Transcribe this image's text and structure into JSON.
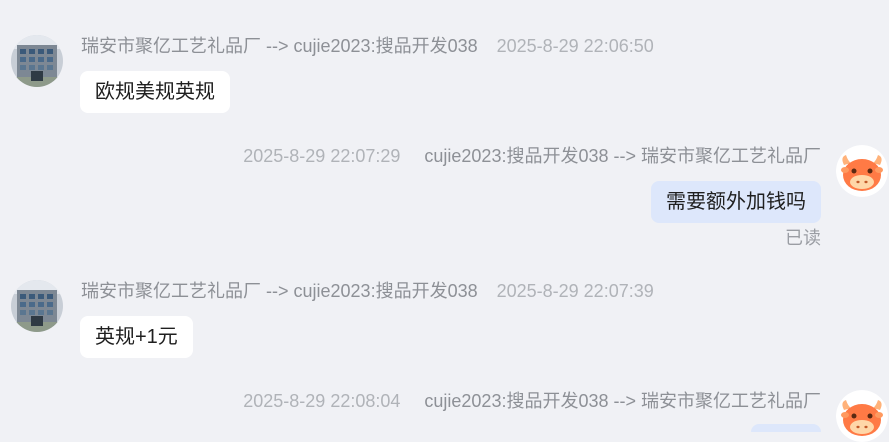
{
  "chat": {
    "messages": [
      {
        "direction": "incoming",
        "route": "瑞安市聚亿工艺礼品厂 --> cujie2023:搜品开发038",
        "time": "2025-8-29 22:06:50",
        "text": "欧规美规英规",
        "avatar_icon": "building-photo-avatar"
      },
      {
        "direction": "outgoing",
        "route": "cujie2023:搜品开发038 --> 瑞安市聚亿工艺礼品厂",
        "time": "2025-8-29 22:07:29",
        "text": "需要额外加钱吗",
        "status": "已读",
        "avatar_icon": "cow-avatar"
      },
      {
        "direction": "incoming",
        "route": "瑞安市聚亿工艺礼品厂 --> cujie2023:搜品开发038",
        "time": "2025-8-29 22:07:39",
        "text": "英规+1元",
        "avatar_icon": "building-photo-avatar"
      },
      {
        "direction": "outgoing",
        "route": "cujie2023:搜品开发038 --> 瑞安市聚亿工艺礼品厂",
        "time": "2025-8-29 22:08:04",
        "text": "",
        "avatar_icon": "cow-avatar"
      }
    ]
  },
  "colors": {
    "background": "#f0f1f5",
    "incoming_bubble": "#ffffff",
    "outgoing_bubble": "#dde7fb",
    "meta_text": "#9a9da3",
    "avatar_orange": "#ff7a45"
  }
}
